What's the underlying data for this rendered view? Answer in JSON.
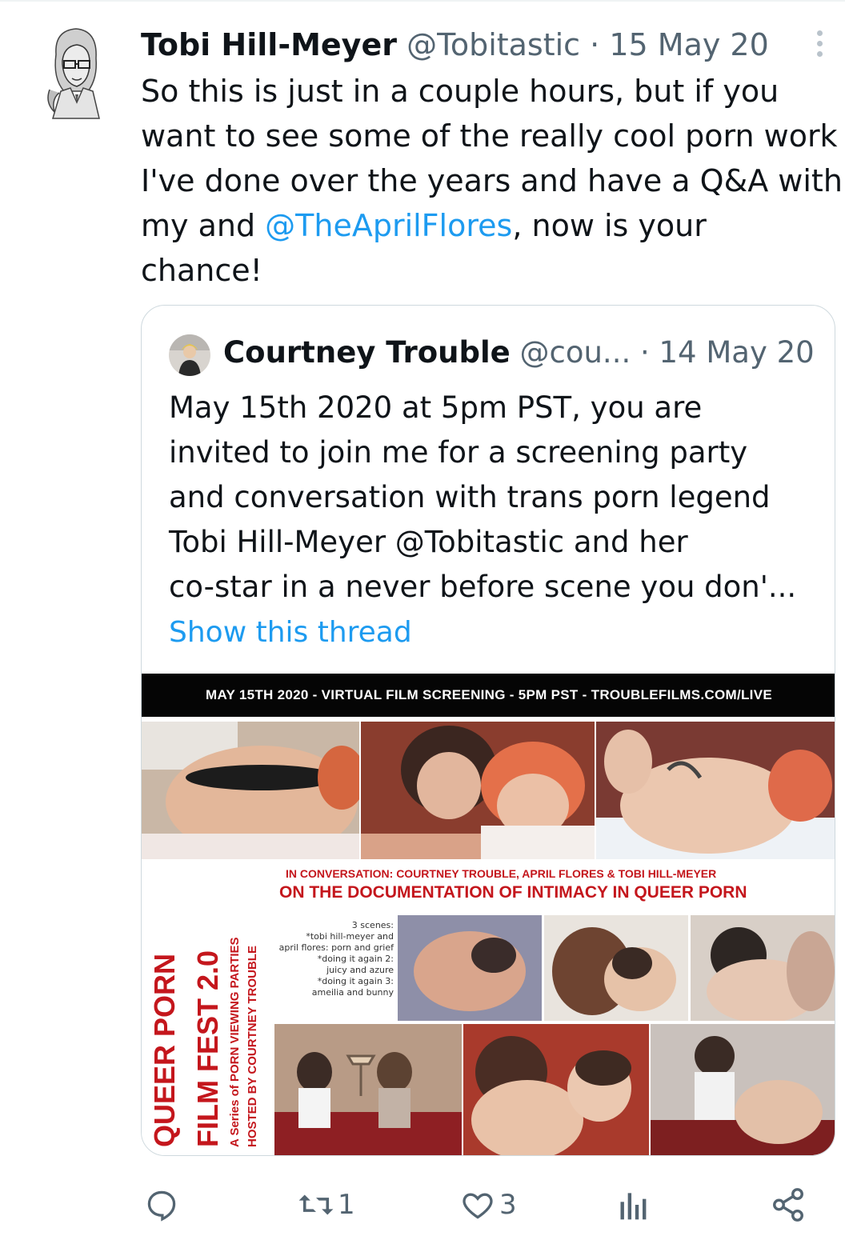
{
  "tweet": {
    "author_name": "Tobi Hill-Meyer",
    "handle": "@Tobitastic",
    "separator": "·",
    "date": "15 May 20",
    "text_lines": [
      "So this is just in a couple hours, but if you",
      "want to see some of the really cool porn work",
      "I've done over the years and have a Q&A with"
    ],
    "text_line4_prefix": "my and ",
    "mention": "@TheAprilFlores",
    "text_line4_suffix": ", now is your",
    "text_line5": "chance!"
  },
  "quoted": {
    "author_name": "Courtney Trouble",
    "handle": "@cou...",
    "separator": "·",
    "date": "14 May 20",
    "text_lines": [
      "May 15th 2020 at 5pm PST, you are",
      "invited to join me for a screening party",
      "and conversation with trans porn legend",
      "Tobi Hill-Meyer @Tobitastic and her",
      "co-star in a never before scene you don'..."
    ],
    "show_thread": "Show this thread",
    "poster": {
      "banner": "MAY 15TH 2020 - VIRTUAL FILM SCREENING - 5PM PST  - TROUBLEFILMS.COM/LIVE",
      "title_line1": "QUEER PORN",
      "title_line2": "FILM FEST 2.0",
      "subtitle_line1": "A Series of PORN VIEWING PARTIES",
      "subtitle_line2": "HOSTED BY COURTNEY TROUBLE",
      "conversation": "IN CONVERSATION: COURTNEY TROUBLE, APRIL FLORES & TOBI HILL-MEYER",
      "headline": "ON THE DOCUMENTATION OF INTIMACY IN QUEER PORN",
      "scenes": [
        "3 scenes:",
        "*tobi hill-meyer and",
        "april flores: porn and grief",
        "*doing it again 2:",
        "juicy and azure",
        "*doing it again 3:",
        "ameilia and bunny"
      ]
    }
  },
  "actions": {
    "reply_icon": "reply-icon",
    "retweet_icon": "retweet-icon",
    "retweet_count": "1",
    "like_icon": "heart-icon",
    "like_count": "3",
    "analytics_icon": "analytics-icon",
    "share_icon": "share-icon"
  },
  "colors": {
    "link": "#1d9bf0",
    "muted": "#536471",
    "poster_red": "#c4161c"
  }
}
